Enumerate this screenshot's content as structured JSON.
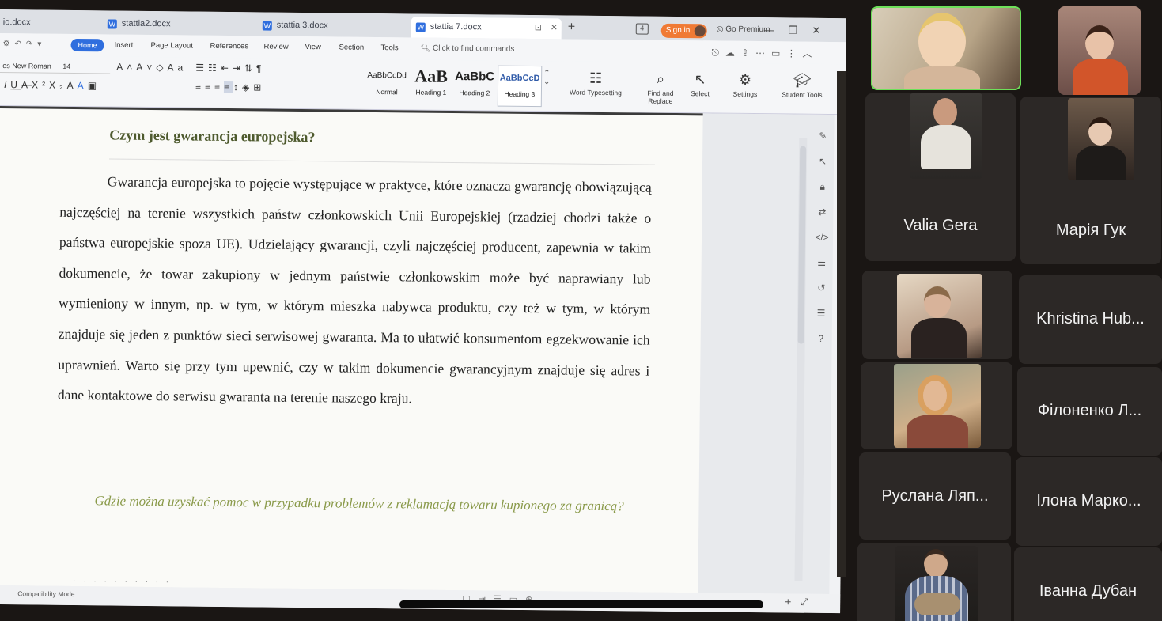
{
  "tabs": [
    {
      "label": "io.docx"
    },
    {
      "label": "stattia2.docx"
    },
    {
      "label": "stattia 3.docx"
    },
    {
      "label": "stattia 7.docx"
    }
  ],
  "title_bar": {
    "sign_in": "Sign in",
    "go_premium": "Go Premium"
  },
  "menu": {
    "home": "Home",
    "items": [
      "Insert",
      "Page Layout",
      "References",
      "Review",
      "View",
      "Section",
      "Tools"
    ],
    "search_placeholder": "Click to find commands"
  },
  "ribbon": {
    "font_name": "es New Roman",
    "font_size": "14",
    "styles": [
      {
        "sample": "AaBbCcDd",
        "label": "Normal"
      },
      {
        "sample": "AaB",
        "label": "Heading 1"
      },
      {
        "sample": "AaBbC",
        "label": "Heading 2"
      },
      {
        "sample": "AaBbCcD",
        "label": "Heading 3"
      }
    ],
    "tools": [
      "Word Typesetting",
      "Find and Replace",
      "Select",
      "Settings",
      "Student Tools"
    ]
  },
  "document": {
    "heading": "Czym jest gwarancja europejska?",
    "paragraph": "Gwarancja europejska to pojęcie występujące w praktyce, które oznacza gwarancję obowiązującą najczęściej na terenie wszystkich państw członkowskich Unii Europejskiej (rzadziej chodzi także o państwa europejskie spoza UE). Udzielający gwarancji, czyli najczęściej producent, zapewnia w takim dokumencie, że towar zakupiony w jednym państwie członkowskim może być naprawiany lub wymieniony w innym, np. w tym, w którym mieszka nabywca produktu, czy też w tym, w którym znajduje się jeden z punktów sieci serwisowej gwaranta. Ma to ułatwić konsumentom egzekwowanie ich uprawnień. Warto się przy tym upewnić, czy w takim dokumencie gwarancyjnym znajduje się adres i dane kontaktowe do serwisu gwaranta na terenie naszego kraju.",
    "subheading": "Gdzie można uzyskać pomoc w przypadku problemów z reklamacją towaru kupionego za granicą?"
  },
  "status": {
    "mode": "Compatibility Mode"
  },
  "participants": [
    {
      "name": ""
    },
    {
      "name": ""
    },
    {
      "name": ""
    },
    {
      "name": ""
    },
    {
      "name": "Valia Gera"
    },
    {
      "name": "Марія Гук"
    },
    {
      "name": ""
    },
    {
      "name": "Khristina Hub..."
    },
    {
      "name": ""
    },
    {
      "name": "Філоненко Л..."
    },
    {
      "name": "Руслана Ляп..."
    },
    {
      "name": "Ілона Марко..."
    },
    {
      "name": ""
    },
    {
      "name": "Іванна Дубан"
    }
  ],
  "colors": {
    "accent": "#2f6ede",
    "sign_in": "#f07a34",
    "speaking_border": "#6ee05a",
    "heading_text": "#4e5a2e",
    "subheading_text": "#8a9a4a"
  }
}
